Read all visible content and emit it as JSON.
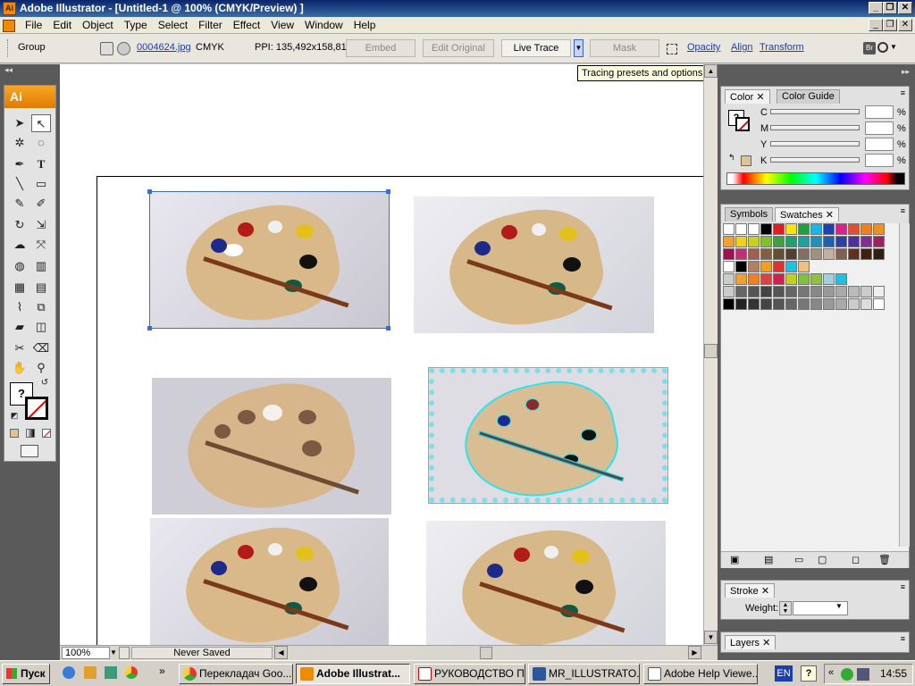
{
  "window": {
    "title": "Adobe Illustrator - [Untitled-1 @ 100% (CMYK/Preview) ]",
    "icon_label": "Ai"
  },
  "menu": [
    "File",
    "Edit",
    "Object",
    "Type",
    "Select",
    "Filter",
    "Effect",
    "View",
    "Window",
    "Help"
  ],
  "control_bar": {
    "selection": "Group",
    "filename": "0004624.jpg",
    "color_mode": "CMYK",
    "ppi": "PPI: 135,492x158,813",
    "embed": "Embed",
    "edit_original": "Edit Original",
    "live_trace": "Live Trace",
    "mask": "Mask",
    "opacity": "Opacity",
    "align": "Align",
    "transform": "Transform"
  },
  "tooltip": "Tracing presets and options",
  "tools_panel": {
    "logo": "Ai"
  },
  "status_bar": {
    "zoom": "100%",
    "status": "Never Saved"
  },
  "color_panel": {
    "tabs": [
      "Color",
      "Color Guide"
    ],
    "channels": [
      {
        "label": "C",
        "unit": "%"
      },
      {
        "label": "M",
        "unit": "%"
      },
      {
        "label": "Y",
        "unit": "%"
      },
      {
        "label": "K",
        "unit": "%"
      }
    ]
  },
  "swatches_panel": {
    "tabs": [
      "Symbols",
      "Swatches"
    ]
  },
  "stroke_panel": {
    "tab": "Stroke",
    "weight_label": "Weight:"
  },
  "layers_panel": {
    "tab": "Layers"
  },
  "taskbar": {
    "start": "Пуск",
    "tasks": [
      "Переклaдач Goo...",
      "Adobe Illustrat...",
      "РУКОВОДСТВО П...",
      "MR_ILLUSTRATO...",
      "Adobe Help Viewe..."
    ],
    "lang": "EN",
    "clock": "14:55"
  }
}
